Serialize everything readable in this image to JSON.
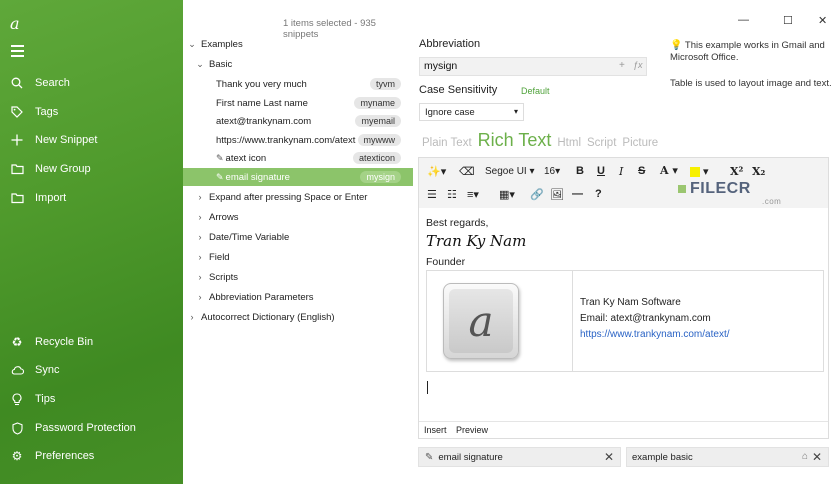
{
  "app": {
    "logo_glyph": "a",
    "accent_color": "#4f9a2c"
  },
  "sidebar": {
    "items_top": [
      {
        "label": "Search",
        "icon": "search-icon"
      },
      {
        "label": "Tags",
        "icon": "tag-icon"
      },
      {
        "label": "New Snippet",
        "icon": "plus-icon"
      },
      {
        "label": "New Group",
        "icon": "folder-plus-icon"
      },
      {
        "label": "Import",
        "icon": "import-folder-icon"
      }
    ],
    "items_bottom": [
      {
        "label": "Recycle Bin",
        "icon": "recycle-icon"
      },
      {
        "label": "Sync",
        "icon": "cloud-icon"
      },
      {
        "label": "Tips",
        "icon": "lightbulb-icon"
      },
      {
        "label": "Password Protection",
        "icon": "shield-icon"
      },
      {
        "label": "Preferences",
        "icon": "gear-icon"
      }
    ]
  },
  "tree": {
    "status": "1 items selected - 935 snippets",
    "root": "Examples",
    "basic": "Basic",
    "snippets": [
      {
        "name": "Thank you very much",
        "abbr": "tyvm"
      },
      {
        "name": "First name Last name",
        "abbr": "myname"
      },
      {
        "name": "atext@trankynam.com",
        "abbr": "myemail"
      },
      {
        "name": "https://www.trankynam.com/atext",
        "abbr": "mywww"
      },
      {
        "name": "atext icon",
        "abbr": "atexticon"
      },
      {
        "name": "email signature",
        "abbr": "mysign"
      }
    ],
    "groups": [
      "Expand after pressing Space or Enter",
      "Arrows",
      "Date/Time Variable",
      "Field",
      "Scripts",
      "Abbreviation Parameters"
    ],
    "autocorrect": "Autocorrect Dictionary (English)"
  },
  "window_controls": {
    "close": "✕",
    "maximize": "☐",
    "minimize": "—"
  },
  "detail": {
    "abbreviation_label": "Abbreviation",
    "abbreviation_value": "mysign",
    "case_label": "Case Sensitivity",
    "case_default": "Default",
    "case_value": "Ignore case",
    "hint_line1": "This example works in Gmail and Microsoft Office.",
    "hint_line2": "Table is used to layout image and text.",
    "tabs": [
      "Plain Text",
      "Rich Text",
      "Html",
      "Script",
      "Picture"
    ],
    "active_tab": "Rich Text"
  },
  "toolbar": {
    "font": "Segoe UI",
    "size": "16",
    "bold": "B",
    "underline": "U",
    "italic": "I",
    "strike": "S",
    "font_color": "A",
    "superscript": "X²",
    "subscript": "X₂",
    "hr": "—",
    "help": "?"
  },
  "editor": {
    "line1": "Best regards,",
    "signature": "Tran Ky Nam",
    "line3": "Founder",
    "company": "Tran Ky Nam Software",
    "email": "Email: atext@trankynam.com",
    "url": "https://www.trankynam.com/atext/",
    "foot_insert": "Insert",
    "foot_preview": "Preview"
  },
  "chips": {
    "left": "email signature",
    "right": "example basic"
  },
  "watermark": {
    "brand": "FILECR",
    "suffix": ".com"
  }
}
